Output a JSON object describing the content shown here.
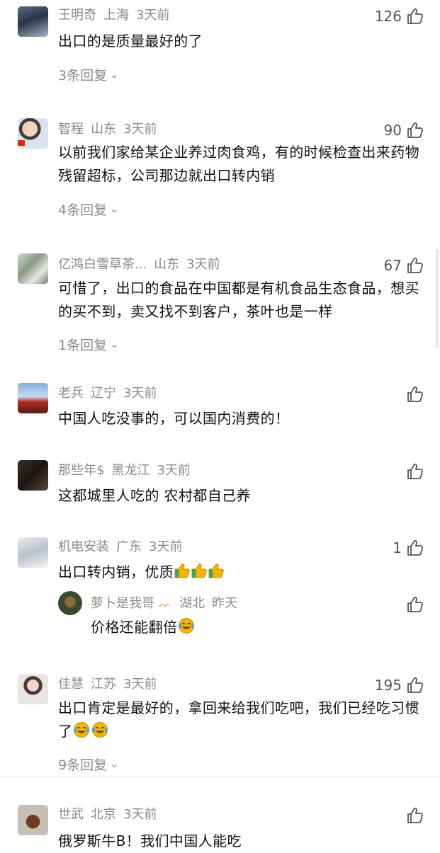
{
  "comments": [
    {
      "user": "王明奇",
      "location": "上海",
      "time": "3天前",
      "likes": "126",
      "text": "出口的是质量最好的了",
      "replies": "3条回复"
    },
    {
      "user": "智程",
      "location": "山东",
      "time": "3天前",
      "likes": "90",
      "text": "以前我们家给某企业养过肉食鸡，有的时候检查出来药物残留超标，公司那边就出口转内销",
      "replies": "4条回复"
    },
    {
      "user": "亿鸿白雪草茶...",
      "location": "山东",
      "time": "3天前",
      "likes": "67",
      "text": "可惜了，出口的食品在中国都是有机食品生态食品，想买的买不到，卖又找不到客户，茶叶也是一样",
      "replies": "1条回复"
    },
    {
      "user": "老兵",
      "location": "辽宁",
      "time": "3天前",
      "likes": "",
      "text": "中国人吃没事的，可以国内消费的！"
    },
    {
      "user": "那些年$",
      "location": "黑龙江",
      "time": "3天前",
      "likes": "",
      "text": "这都城里人吃的 农村都自己养"
    },
    {
      "user": "机电安装",
      "location": "广东",
      "time": "3天前",
      "likes": "1",
      "text": "出口转内销，优质",
      "reply": {
        "user": "萝卜是我哥",
        "location": "湖北",
        "time": "昨天",
        "text": "价格还能翻倍"
      }
    },
    {
      "user": "佳慧",
      "location": "江苏",
      "time": "3天前",
      "likes": "195",
      "text": "出口肯定是最好的，拿回来给我们吃吧，我们已经吃习惯了",
      "replies": "9条回复"
    },
    {
      "user": "世武",
      "location": "北京",
      "time": "3天前",
      "likes": "",
      "text": "俄罗斯牛B！我们中国人能吃"
    }
  ],
  "icons": {
    "like": "thumbs-up-outline-icon",
    "expand": "chevron-down-icon",
    "emoji_thumbs": "thumbs-up-emoji",
    "emoji_laugh": "laugh-cry-emoji",
    "badge": "vip-badge-icon"
  },
  "colors": {
    "meta": "#8a8a8a",
    "text": "#111111",
    "divider": "#ececec",
    "emoji": "#f4b400"
  }
}
